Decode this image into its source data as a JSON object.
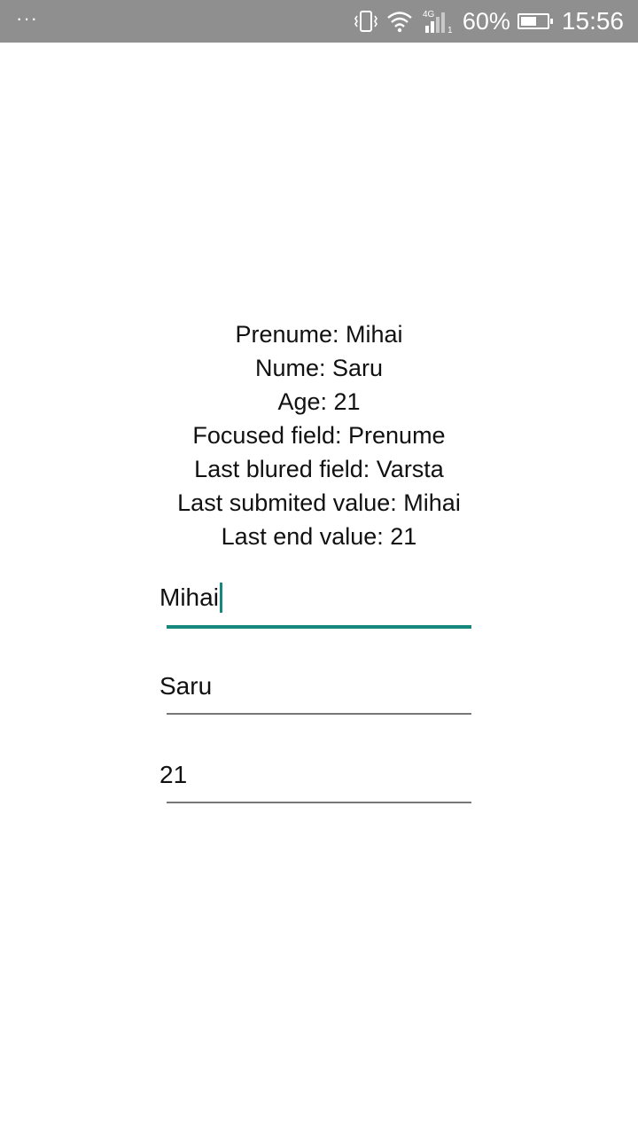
{
  "status_bar": {
    "overflow_icon": "more-dots-icon",
    "battery_percent": "60%",
    "battery_level": 0.6,
    "time": "15:56",
    "signal_label": "4G",
    "sim_slot": "1"
  },
  "info": {
    "prenume": "Prenume: Mihai",
    "nume": "Nume: Saru",
    "age": "Age: 21",
    "focused_field": "Focused field: Prenume",
    "last_blured_field": "Last blured field: Varsta",
    "last_submited_value": "Last submited value: Mihai",
    "last_end_value": "Last end value: 21"
  },
  "fields": {
    "prenume_value": "Mihai",
    "nume_value": "Saru",
    "age_value": "21"
  },
  "colors": {
    "accent": "#16877d",
    "status_bar": "#8f8f8f",
    "underline": "#777777"
  }
}
